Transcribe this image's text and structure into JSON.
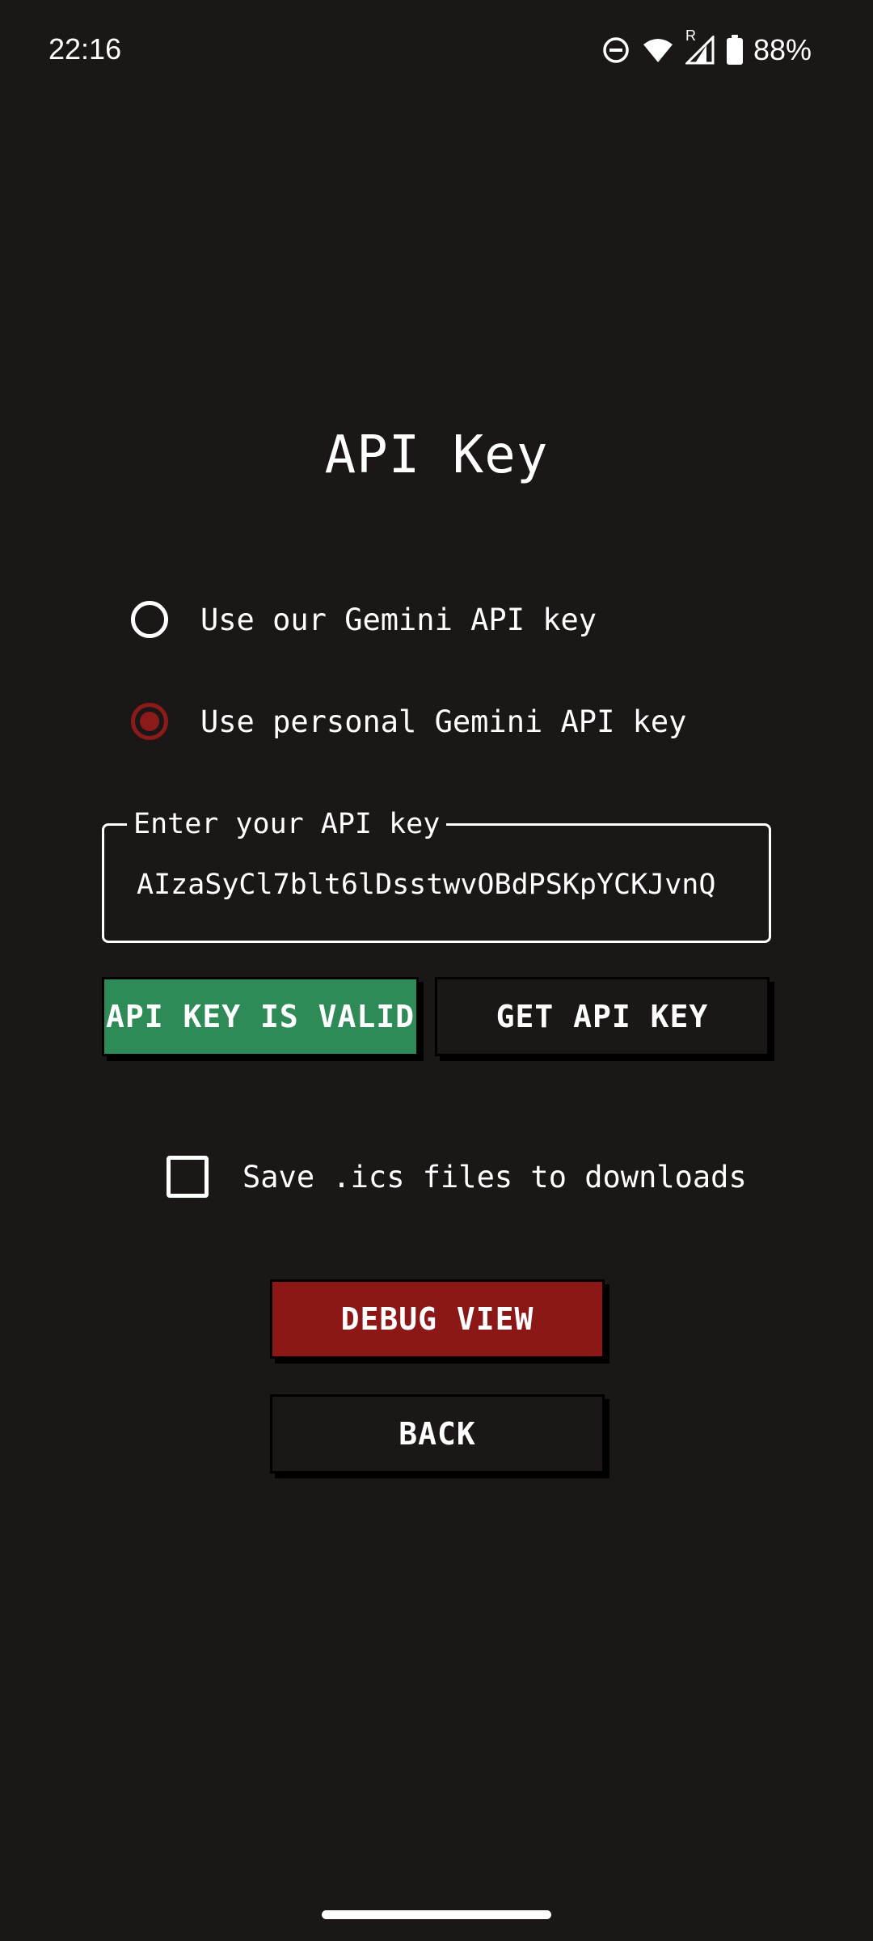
{
  "status_bar": {
    "time": "22:16",
    "battery_percent": "88%",
    "network_roaming_indicator": "R",
    "icons": [
      "do-not-disturb-icon",
      "wifi-icon",
      "cell-signal-icon",
      "battery-icon"
    ]
  },
  "page": {
    "title": "API Key"
  },
  "radio_options": [
    {
      "label": "Use our Gemini API key",
      "selected": false
    },
    {
      "label": "Use personal Gemini API key",
      "selected": true
    }
  ],
  "api_key_field": {
    "label": "Enter your API key",
    "value": "AIzaSyCl7blt6lDsstwvOBdPSKpYCKJvnQ"
  },
  "buttons": {
    "validate": "API KEY IS VALID",
    "get_key": "GET API KEY",
    "debug": "DEBUG VIEW",
    "back": "BACK"
  },
  "checkbox": {
    "label": "Save .ics files to downloads",
    "checked": false
  },
  "colors": {
    "background": "#1c1717",
    "valid_green": "#2e8b57",
    "accent_red": "#8b1717",
    "text": "#ffffff"
  }
}
